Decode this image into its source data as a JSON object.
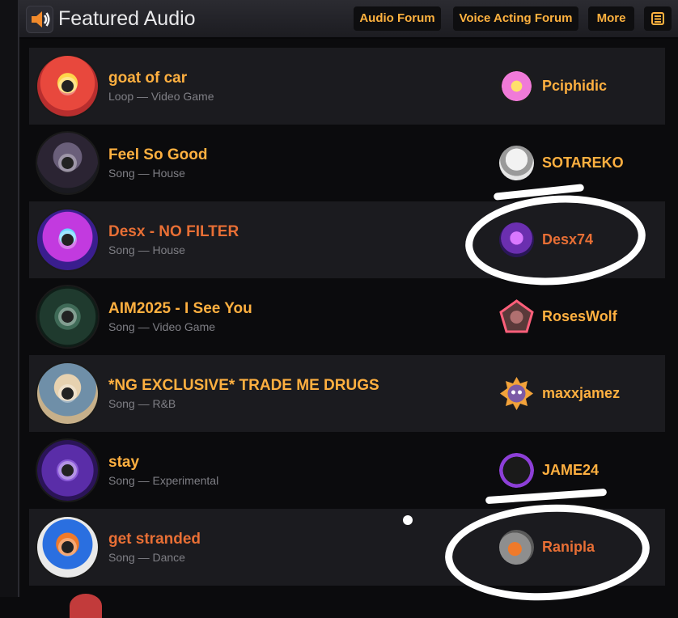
{
  "header": {
    "title": "Featured Audio",
    "nav": [
      "Audio Forum",
      "Voice Acting Forum",
      "More"
    ]
  },
  "tracks": [
    {
      "title": "goat of car",
      "meta": "Loop — Video Game",
      "user": "Pciphidic",
      "title_color": "#ffb040"
    },
    {
      "title": "Feel So Good",
      "meta": "Song — House",
      "user": "SOTAREKO",
      "title_color": "#ffb040"
    },
    {
      "title": "Desx - NO FILTER",
      "meta": "Song — House",
      "user": "Desx74",
      "title_color": "#e86f35"
    },
    {
      "title": "AIM2025 - I See You",
      "meta": "Song — Video Game",
      "user": "RosesWolf",
      "title_color": "#ffb040"
    },
    {
      "title": "*NG EXCLUSIVE* TRADE ME DRUGS",
      "meta": "Song — R&B",
      "user": "maxxjamez",
      "title_color": "#ffb040"
    },
    {
      "title": "stay",
      "meta": "Song — Experimental",
      "user": "JAME24",
      "title_color": "#ffb040"
    },
    {
      "title": "get stranded",
      "meta": "Song — Dance",
      "user": "Ranipla",
      "title_color": "#e86f35"
    }
  ],
  "colors": {
    "accent": "#ffb040",
    "accent_alt": "#e86f35",
    "header_bg": "#26262b",
    "row_bg": "#1b1b1f"
  }
}
